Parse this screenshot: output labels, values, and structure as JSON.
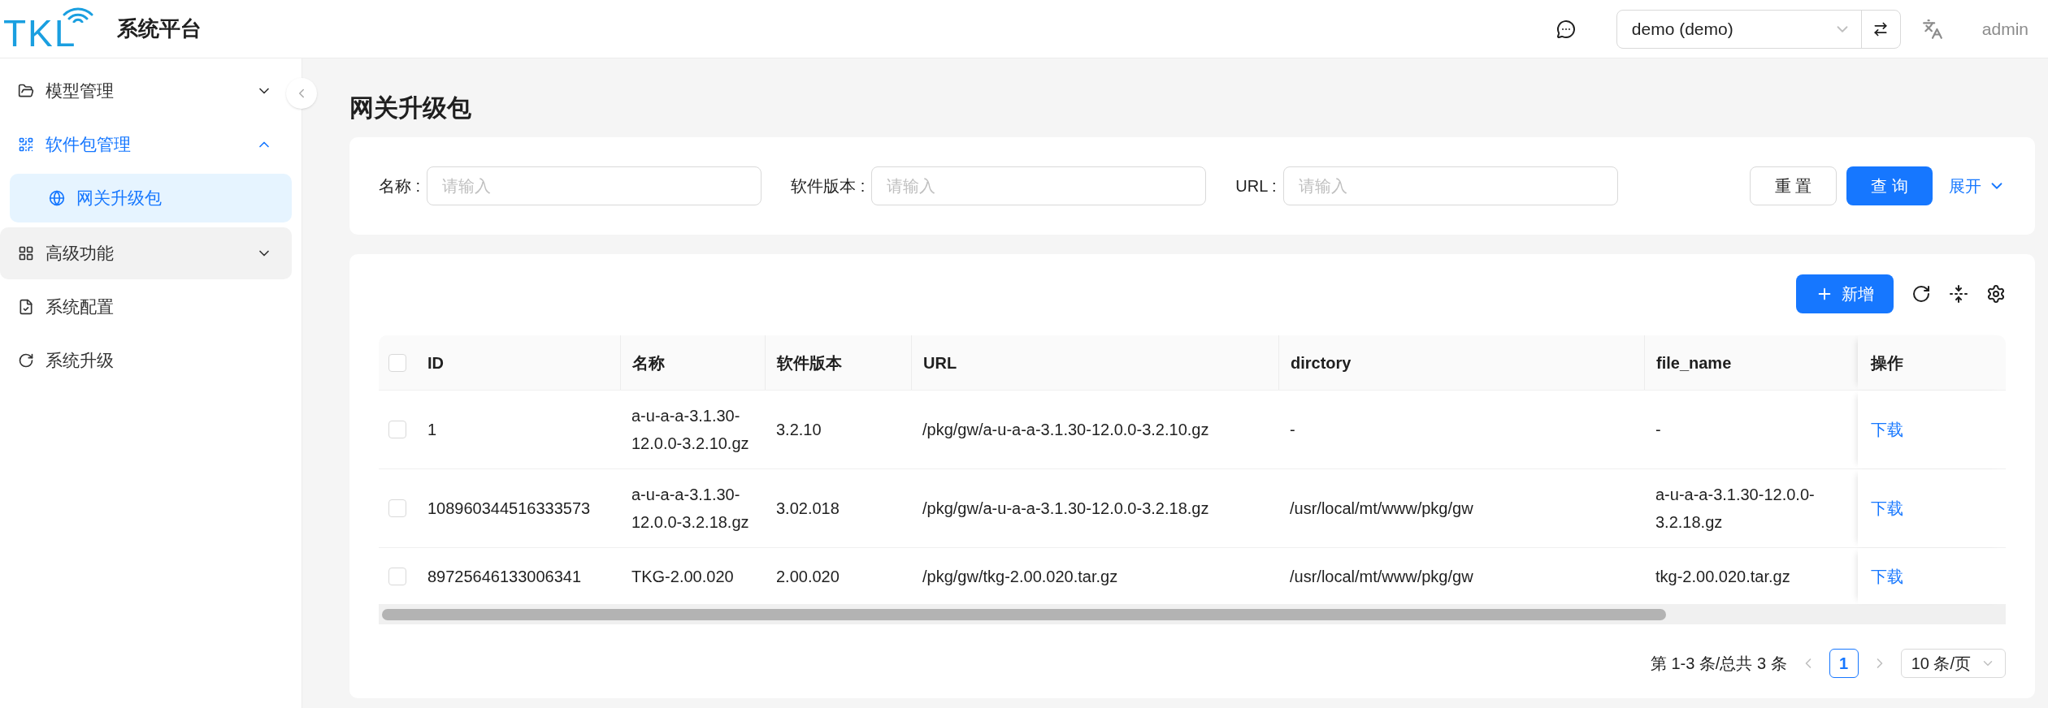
{
  "header": {
    "logo": "TKL",
    "title": "系统平台",
    "tenant_select": "demo (demo)",
    "user": "admin"
  },
  "sidebar": {
    "items": [
      {
        "label": "模型管理",
        "kind": "group",
        "expanded": false,
        "hovered": false
      },
      {
        "label": "软件包管理",
        "kind": "group",
        "expanded": true,
        "hovered": false,
        "children": [
          {
            "label": "网关升级包",
            "selected": true
          }
        ]
      },
      {
        "label": "高级功能",
        "kind": "group",
        "expanded": false,
        "hovered": true
      },
      {
        "label": "系统配置",
        "kind": "link",
        "hovered": false
      },
      {
        "label": "系统升级",
        "kind": "link",
        "hovered": false
      }
    ]
  },
  "page_title": "网关升级包",
  "filters": {
    "fields": [
      {
        "label": "名称 :",
        "placeholder": "请输入"
      },
      {
        "label": "软件版本 :",
        "placeholder": "请输入"
      },
      {
        "label": "URL :",
        "placeholder": "请输入"
      }
    ],
    "reset": "重 置",
    "search": "查 询",
    "expand": "展开"
  },
  "toolbar": {
    "add": "新增"
  },
  "table": {
    "all_checked": false,
    "columns": [
      "ID",
      "名称",
      "软件版本",
      "URL",
      "dirctory",
      "file_name",
      "操作"
    ],
    "rows": [
      {
        "checked": false,
        "cells": [
          "1",
          "a-u-a-a-3.1.30-12.0.0-3.2.10.gz",
          "3.2.10",
          "/pkg/gw/a-u-a-a-3.1.30-12.0.0-3.2.10.gz",
          "-",
          "-"
        ],
        "action": "下载"
      },
      {
        "checked": false,
        "cells": [
          "108960344516333573",
          "a-u-a-a-3.1.30-12.0.0-3.2.18.gz",
          "3.02.018",
          "/pkg/gw/a-u-a-a-3.1.30-12.0.0-3.2.18.gz",
          "/usr/local/mt/www/pkg/gw",
          "a-u-a-a-3.1.30-12.0.0-3.2.18.gz"
        ],
        "action": "下载"
      },
      {
        "checked": false,
        "cells": [
          "89725646133006341",
          "TKG-2.00.020",
          "2.00.020",
          "/pkg/gw/tkg-2.00.020.tar.gz",
          "/usr/local/mt/www/pkg/gw",
          "tkg-2.00.020.tar.gz"
        ],
        "action": "下载"
      }
    ]
  },
  "pagination": {
    "summary": "第 1-3 条/总共 3 条",
    "pages": [
      {
        "label": "1",
        "selected": true
      }
    ],
    "page_size": "10 条/页"
  }
}
